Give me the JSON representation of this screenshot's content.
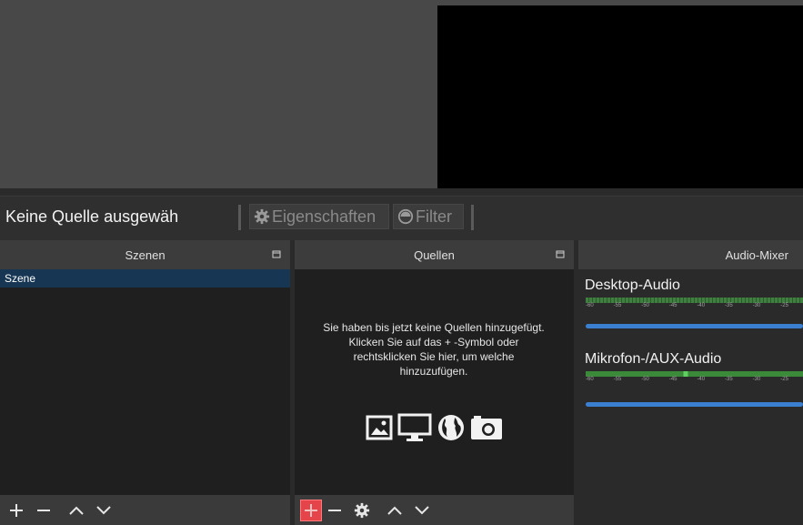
{
  "source_bar": {
    "no_source_label": "Keine Quelle ausgewäh",
    "properties_label": "Eigenschaften",
    "filter_label": "Filter"
  },
  "docks": {
    "scenes": {
      "title": "Szenen",
      "items": [
        "Szene"
      ]
    },
    "sources": {
      "title": "Quellen",
      "empty_message": "Sie haben bis jetzt keine Quellen hinzugefügt. Klicken Sie auf das + -Symbol oder rechtsklicken Sie hier, um welche hinzuzufügen."
    },
    "mixer": {
      "title": "Audio-Mixer",
      "channels": [
        {
          "name": "Desktop-Audio",
          "ticks": [
            "-60",
            "-55",
            "-50",
            "-45",
            "-40",
            "-35",
            "-30",
            "-25"
          ]
        },
        {
          "name": "Mikrofon-/AUX-Audio",
          "ticks": [
            "-60",
            "-55",
            "-50",
            "-45",
            "-40",
            "-35",
            "-30",
            "-25"
          ]
        }
      ]
    }
  },
  "icons": {
    "float": "float-icon",
    "gear": "gear-icon",
    "filter": "filter-icon",
    "image": "image-icon",
    "display": "display-icon",
    "globe": "globe-icon",
    "camera": "camera-icon"
  },
  "colors": {
    "accent": "#3b7fd0",
    "selected_row": "#163654",
    "add_highlight": "#e5454a"
  }
}
